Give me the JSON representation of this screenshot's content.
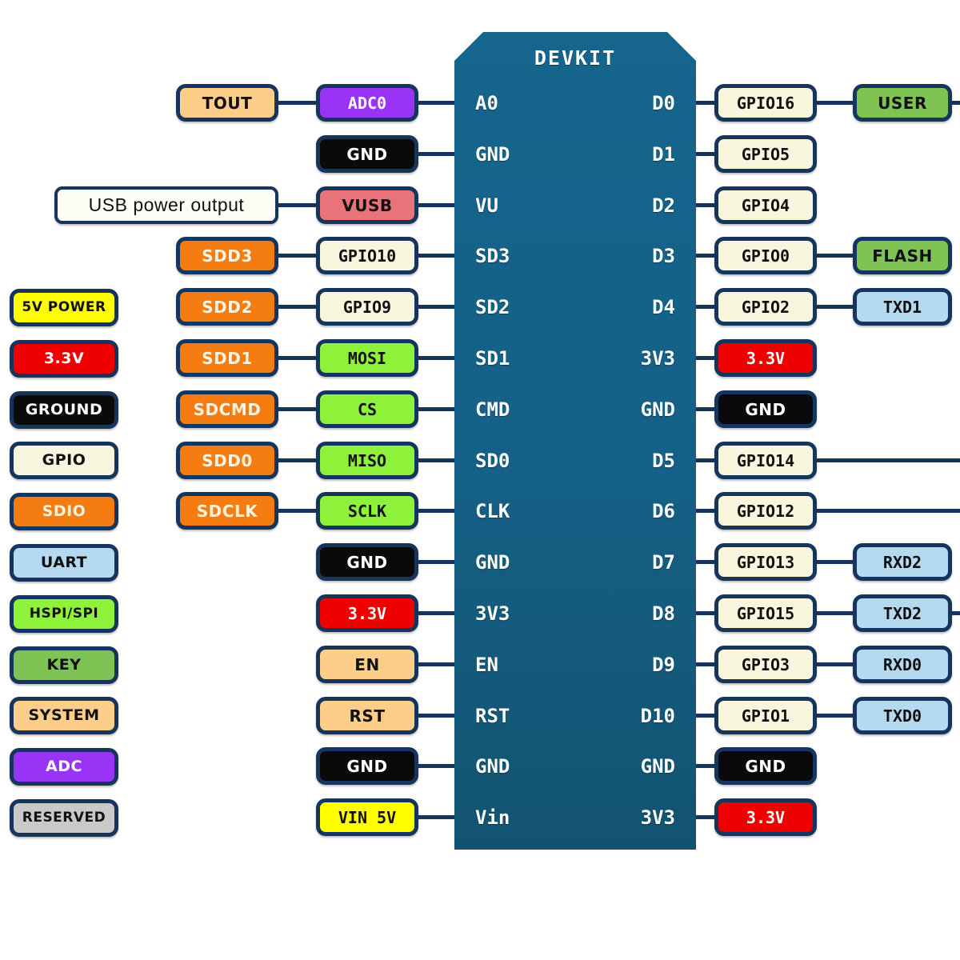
{
  "board": {
    "title": "DEVKIT",
    "left_pins": [
      "A0",
      "GND",
      "VU",
      "SD3",
      "SD2",
      "SD1",
      "CMD",
      "SD0",
      "CLK",
      "GND",
      "3V3",
      "EN",
      "RST",
      "GND",
      "Vin"
    ],
    "right_pins": [
      "D0",
      "D1",
      "D2",
      "D3",
      "D4",
      "3V3",
      "GND",
      "D5",
      "D6",
      "D7",
      "D8",
      "D9",
      "D10",
      "GND",
      "3V3"
    ]
  },
  "legend": {
    "items": [
      {
        "label": "5V POWER",
        "color": "#ffff00",
        "text": "#111111"
      },
      {
        "label": "3.3V",
        "color": "#ee0000",
        "text": "#ffffff"
      },
      {
        "label": "GROUND",
        "color": "#0a0a0a",
        "text": "#ffffff"
      },
      {
        "label": "GPIO",
        "color": "#f8f6dc",
        "text": "#111111"
      },
      {
        "label": "SDIO",
        "color": "#f57c10",
        "text": "#fdf3e0"
      },
      {
        "label": "UART",
        "color": "#b4d9f0",
        "text": "#111111"
      },
      {
        "label": "HSPI/SPI",
        "color": "#8ef13a",
        "text": "#111111"
      },
      {
        "label": "KEY",
        "color": "#80c355",
        "text": "#111111"
      },
      {
        "label": "SYSTEM",
        "color": "#fcce8a",
        "text": "#111111"
      },
      {
        "label": "ADC",
        "color": "#9933f5",
        "text": "#ffffff"
      },
      {
        "label": "RESERVED",
        "color": "#c9c9c9",
        "text": "#111111"
      }
    ]
  },
  "left_outer": [
    {
      "label": "TOUT",
      "color": "#fcce8a",
      "text": "#111111",
      "mono": false
    },
    {
      "label": "USB power output",
      "color": "#fdfdf6",
      "text": "#111111",
      "mono": false,
      "plain": true
    },
    {
      "label": "SDD3",
      "color": "#f57c10",
      "text": "#fdf3e0",
      "mono": false
    },
    {
      "label": "SDD2",
      "color": "#f57c10",
      "text": "#fdf3e0",
      "mono": false
    },
    {
      "label": "SDD1",
      "color": "#f57c10",
      "text": "#fdf3e0",
      "mono": false
    },
    {
      "label": "SDCMD",
      "color": "#f57c10",
      "text": "#fdf3e0",
      "mono": false
    },
    {
      "label": "SDD0",
      "color": "#f57c10",
      "text": "#fdf3e0",
      "mono": false
    },
    {
      "label": "SDCLK",
      "color": "#f57c10",
      "text": "#fdf3e0",
      "mono": false
    }
  ],
  "left_inner": [
    {
      "label": "ADC0",
      "color": "#9933f5",
      "text": "#ffffff",
      "mono": true
    },
    {
      "label": "GND",
      "color": "#0a0a0a",
      "text": "#ffffff",
      "mono": false
    },
    {
      "label": "VUSB",
      "color": "#e8737a",
      "text": "#111111",
      "mono": false
    },
    {
      "label": "GPIO10",
      "color": "#f8f6dc",
      "text": "#111111",
      "mono": true
    },
    {
      "label": "GPIO9",
      "color": "#f8f6dc",
      "text": "#111111",
      "mono": true
    },
    {
      "label": "MOSI",
      "color": "#8ef13a",
      "text": "#111111",
      "mono": true
    },
    {
      "label": "CS",
      "color": "#8ef13a",
      "text": "#111111",
      "mono": true
    },
    {
      "label": "MISO",
      "color": "#8ef13a",
      "text": "#111111",
      "mono": true
    },
    {
      "label": "SCLK",
      "color": "#8ef13a",
      "text": "#111111",
      "mono": true
    },
    {
      "label": "GND",
      "color": "#0a0a0a",
      "text": "#ffffff",
      "mono": false
    },
    {
      "label": "3.3V",
      "color": "#ee0000",
      "text": "#ffffff",
      "mono": true
    },
    {
      "label": "EN",
      "color": "#fcce8a",
      "text": "#111111",
      "mono": false
    },
    {
      "label": "RST",
      "color": "#fcce8a",
      "text": "#111111",
      "mono": false
    },
    {
      "label": "GND",
      "color": "#0a0a0a",
      "text": "#ffffff",
      "mono": false
    },
    {
      "label": "VIN 5V",
      "color": "#ffff00",
      "text": "#111111",
      "mono": true
    }
  ],
  "right_inner": [
    {
      "label": "GPIO16",
      "color": "#f8f6dc",
      "text": "#111111",
      "mono": true
    },
    {
      "label": "GPIO5",
      "color": "#f8f6dc",
      "text": "#111111",
      "mono": true
    },
    {
      "label": "GPIO4",
      "color": "#f8f6dc",
      "text": "#111111",
      "mono": true
    },
    {
      "label": "GPIO0",
      "color": "#f8f6dc",
      "text": "#111111",
      "mono": true
    },
    {
      "label": "GPIO2",
      "color": "#f8f6dc",
      "text": "#111111",
      "mono": true
    },
    {
      "label": "3.3V",
      "color": "#ee0000",
      "text": "#ffffff",
      "mono": true
    },
    {
      "label": "GND",
      "color": "#0a0a0a",
      "text": "#ffffff",
      "mono": false
    },
    {
      "label": "GPIO14",
      "color": "#f8f6dc",
      "text": "#111111",
      "mono": true
    },
    {
      "label": "GPIO12",
      "color": "#f8f6dc",
      "text": "#111111",
      "mono": true
    },
    {
      "label": "GPIO13",
      "color": "#f8f6dc",
      "text": "#111111",
      "mono": true
    },
    {
      "label": "GPIO15",
      "color": "#f8f6dc",
      "text": "#111111",
      "mono": true
    },
    {
      "label": "GPIO3",
      "color": "#f8f6dc",
      "text": "#111111",
      "mono": true
    },
    {
      "label": "GPIO1",
      "color": "#f8f6dc",
      "text": "#111111",
      "mono": true
    },
    {
      "label": "GND",
      "color": "#0a0a0a",
      "text": "#ffffff",
      "mono": false
    },
    {
      "label": "3.3V",
      "color": "#ee0000",
      "text": "#ffffff",
      "mono": true
    }
  ],
  "right_outer": [
    {
      "row": 0,
      "label": "USER",
      "color": "#80c355",
      "text": "#111111",
      "mono": false
    },
    {
      "row": 3,
      "label": "FLASH",
      "color": "#80c355",
      "text": "#111111",
      "mono": false
    },
    {
      "row": 4,
      "label": "TXD1",
      "color": "#b4d9f0",
      "text": "#111111",
      "mono": true
    },
    {
      "row": 9,
      "label": "RXD2",
      "color": "#b4d9f0",
      "text": "#111111",
      "mono": true
    },
    {
      "row": 10,
      "label": "TXD2",
      "color": "#b4d9f0",
      "text": "#111111",
      "mono": true
    },
    {
      "row": 11,
      "label": "RXD0",
      "color": "#b4d9f0",
      "text": "#111111",
      "mono": true
    },
    {
      "row": 12,
      "label": "TXD0",
      "color": "#b4d9f0",
      "text": "#111111",
      "mono": true
    }
  ]
}
